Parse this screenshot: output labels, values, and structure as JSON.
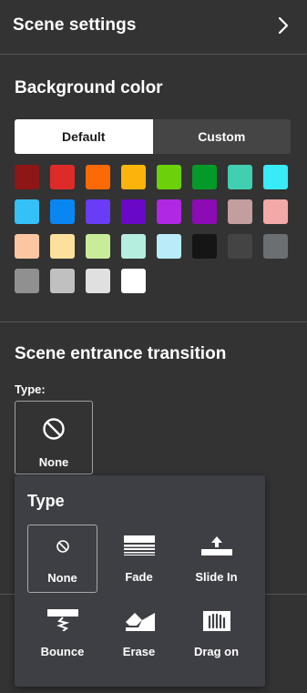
{
  "header": {
    "title": "Scene settings",
    "chevron_icon": "chevron-right-icon"
  },
  "background": {
    "title": "Background color",
    "segments": [
      {
        "label": "Default",
        "active": true
      },
      {
        "label": "Custom",
        "active": false
      }
    ],
    "swatches": [
      "#8e1616",
      "#df2a2a",
      "#fb6a05",
      "#fbb40c",
      "#6cd109",
      "#049a2a",
      "#42ceb1",
      "#39ebf6",
      "#33c1f7",
      "#0a86f2",
      "#6a3cf6",
      "#6a08c8",
      "#b028e3",
      "#8d0bb5",
      "#c29e9e",
      "#f2a9a7",
      "#fcc6a2",
      "#fde09c",
      "#c8ec9a",
      "#b5eddf",
      "#baebf8",
      "#151515",
      "#444444",
      "#6c6f72",
      "#909090",
      "#c0c0c0",
      "#e0e0e0",
      "#ffffff"
    ]
  },
  "transition": {
    "title": "Scene entrance transition",
    "type_label": "Type:",
    "current": {
      "label": "None",
      "icon": "no-symbol-icon"
    }
  },
  "type_popup": {
    "title": "Type",
    "options": [
      {
        "label": "None",
        "icon": "no-symbol-icon",
        "selected": true
      },
      {
        "label": "Fade",
        "icon": "fade-icon",
        "selected": false
      },
      {
        "label": "Slide In",
        "icon": "slide-in-icon",
        "selected": false
      },
      {
        "label": "Bounce",
        "icon": "bounce-icon",
        "selected": false
      },
      {
        "label": "Erase",
        "icon": "erase-icon",
        "selected": false
      },
      {
        "label": "Drag on",
        "icon": "drag-on-icon",
        "selected": false
      }
    ]
  }
}
